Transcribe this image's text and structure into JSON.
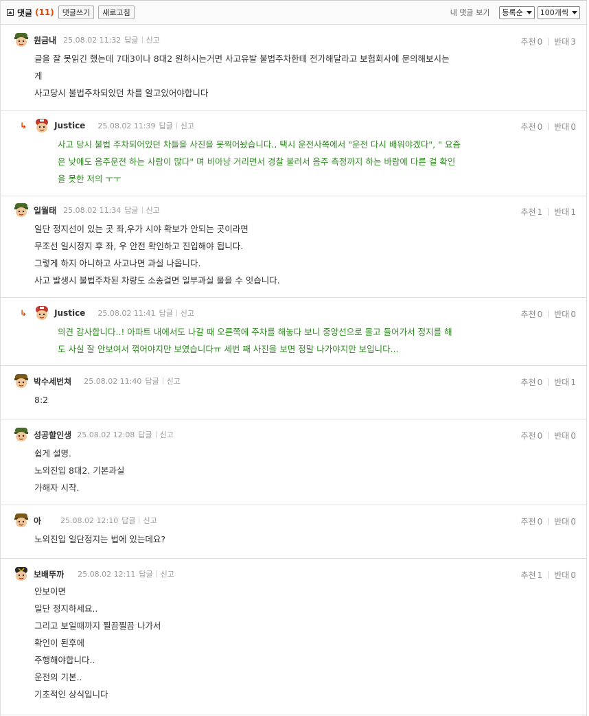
{
  "header": {
    "title": "댓글",
    "count": "(11)",
    "write_button": "댓글쓰기",
    "refresh_button": "새로고침",
    "my_comments": "내 댓글 보기",
    "sort_select": "등록순",
    "perpage_select": "100개씩"
  },
  "labels": {
    "reply": "답글",
    "report": "신고",
    "upvote": "추천",
    "downvote": "반대"
  },
  "comments": [
    {
      "author": "원금내",
      "date": "25.08.02 11:32",
      "up": "0",
      "down": "3",
      "lines": [
        "글을 잘 못읽긴 했는데 7대3이나 8대2 원하시는거면 사고유발 불법주차한테 전가해달라고 보험회사에 문의해보시는",
        "게",
        "사고당시 불법주차되있던 차를 알고있어야합니다"
      ]
    },
    {
      "author": "Justice",
      "date": "25.08.02 11:39",
      "up": "0",
      "down": "0",
      "lines": [
        "사고 당시 불법 주차되어있던 차들을 사진을 못찍어놨습니다.. 택시 운전사쪽에서 \"운전 다시 배워야겠다\", \" 요즘",
        "은 낮에도 음주운전 하는 사람이 많다\" 며 비아냥 거리면서 경찰 불러서 음주 측정까지 하는 바람에 다른 걸 확인",
        "을 못한 저의 ㅜㅜ"
      ]
    },
    {
      "author": "일월태",
      "date": "25.08.02 11:34",
      "up": "1",
      "down": "1",
      "lines": [
        "일단 정지선이 있는 곳 좌,우가 시야 확보가 안되는 곳이라면",
        "무조선 일시정지 후 좌, 우 안전 확인하고 진입해야 됩니다.",
        "그렇게 하지 아니하고 사고나면 과실 나옵니다.",
        "사고 발생시 불법주차된 차량도 소송걸면 일부과실 물을 수 잇습니다."
      ]
    },
    {
      "author": "Justice",
      "date": "25.08.02 11:41",
      "up": "0",
      "down": "0",
      "lines": [
        "의견 감사합니다..! 아파트 내에서도 나갈 때 오른쪽에 주차를 해놓다 보니 중앙선으로 몰고 들어가서 정지를 해",
        "도 사실 잘 안보여서 꺾어야지만 보였습니다ㅠ 세번 째 사진을 보면 정말 나가야지만 보입니다..."
      ]
    },
    {
      "author": "박수세번쳐",
      "date": "25.08.02 11:40",
      "up": "0",
      "down": "1",
      "lines": [
        "8:2"
      ]
    },
    {
      "author": "성공할인생",
      "date": "25.08.02 12:08",
      "up": "0",
      "down": "0",
      "lines": [
        "쉽게 설명.",
        "노외진입 8대2. 기본과실",
        "가해자 시작."
      ]
    },
    {
      "author": "아",
      "date": "25.08.02 12:10",
      "up": "0",
      "down": "0",
      "lines": [
        "노외진입 일단정지는 법에 있는데요?"
      ]
    },
    {
      "author": "보배뚜까",
      "date": "25.08.02 12:11",
      "up": "1",
      "down": "0",
      "lines": [
        "안보이면",
        "일단 정지하세요..",
        "그리고 보일때까지 찔끔찔끔 나가서",
        "확인이 된후에",
        "주행해야합니다..",
        "운전의 기본..",
        "기초적인 상식입니다"
      ]
    }
  ]
}
